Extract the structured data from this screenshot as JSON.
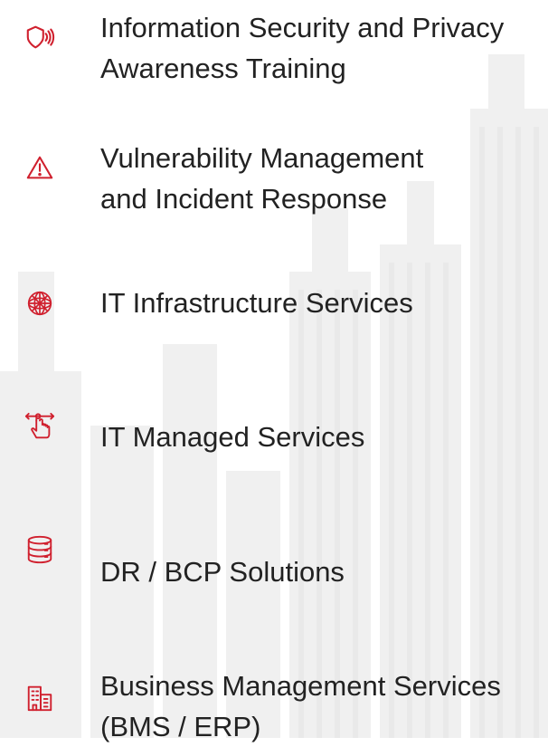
{
  "theme": {
    "accent": "#d0202e",
    "text": "#222222"
  },
  "services": {
    "items": [
      {
        "icon": "shield-signal-icon",
        "label": "Information Security and Privacy\nAwareness Training"
      },
      {
        "icon": "warning-triangle-icon",
        "label": "Vulnerability Management\nand Incident Response"
      },
      {
        "icon": "network-sphere-icon",
        "label": "IT Infrastructure Services"
      },
      {
        "icon": "hand-pointer-icon",
        "label": "IT Managed Services"
      },
      {
        "icon": "database-icon",
        "label": "DR / BCP Solutions"
      },
      {
        "icon": "office-building-icon",
        "label": "Business Management Services\n(BMS / ERP)"
      }
    ]
  }
}
